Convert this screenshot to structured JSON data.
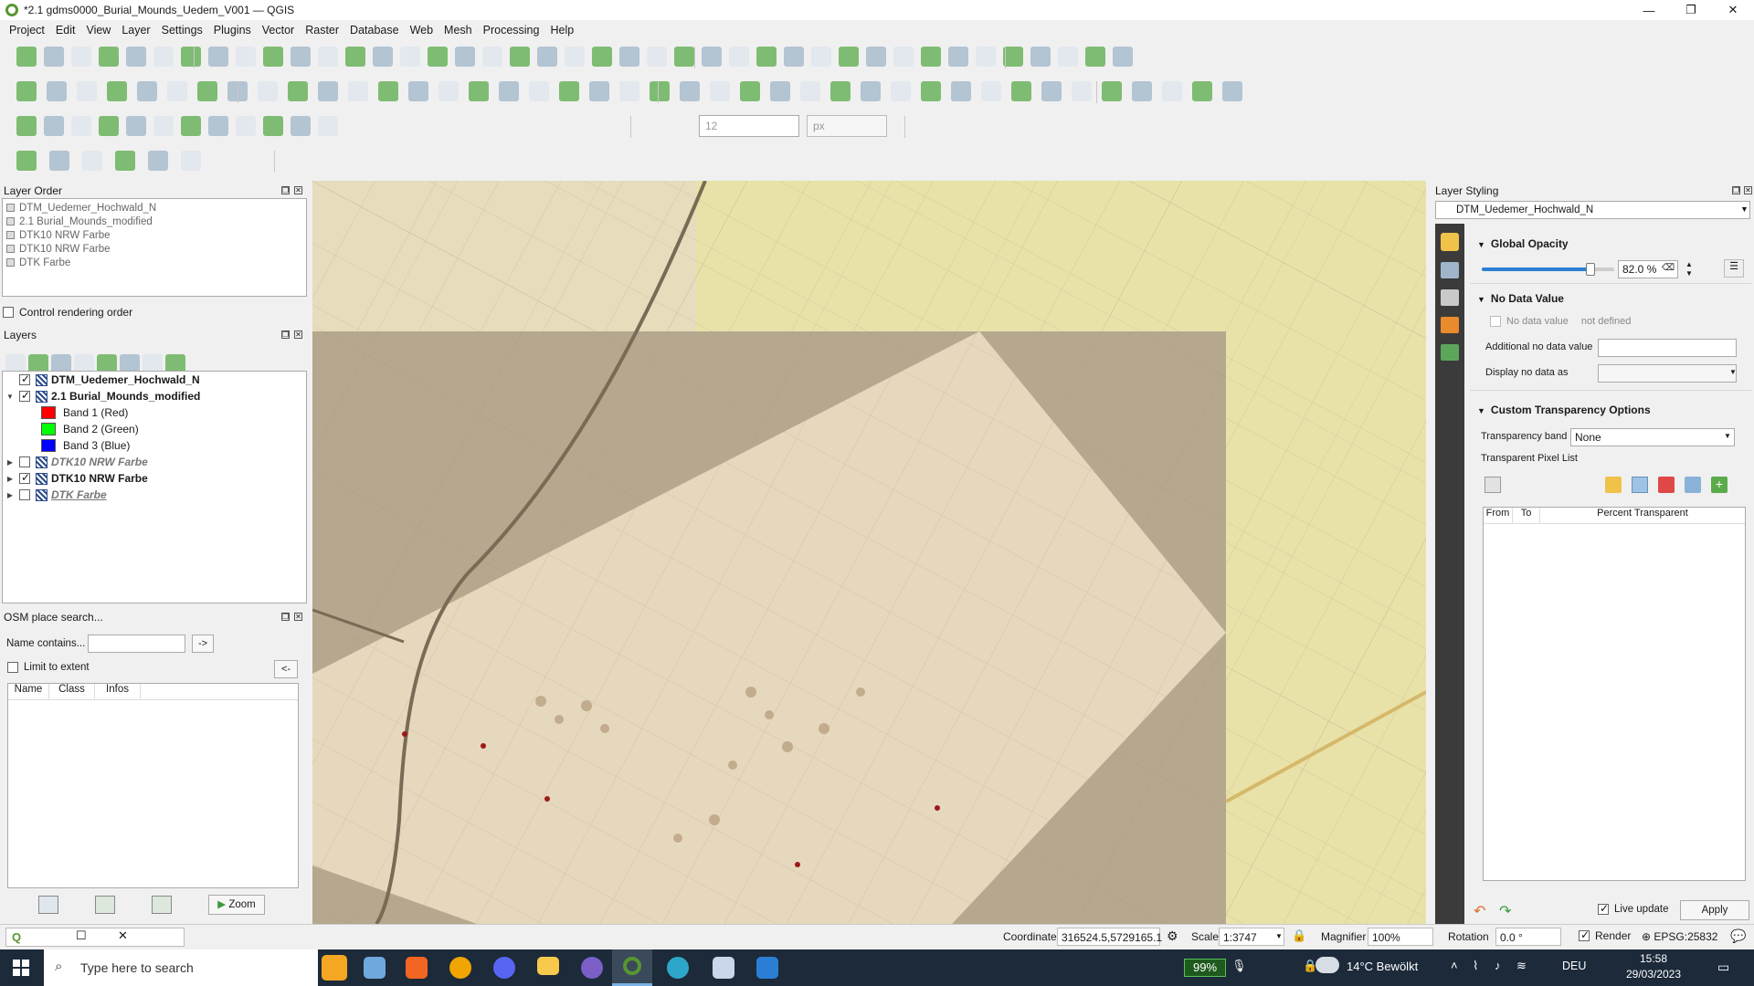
{
  "window": {
    "title": "*2.1 gdms0000_Burial_Mounds_Uedem_V001 — QGIS"
  },
  "menu": [
    "Project",
    "Edit",
    "View",
    "Layer",
    "Settings",
    "Plugins",
    "Vector",
    "Raster",
    "Database",
    "Web",
    "Mesh",
    "Processing",
    "Help"
  ],
  "digitize": {
    "size_value": "12",
    "unit": "px"
  },
  "layer_order": {
    "title": "Layer Order",
    "items": [
      "DTM_Uedemer_Hochwald_N",
      "2.1 Burial_Mounds_modified",
      "DTK10 NRW Farbe",
      "DTK10 NRW Farbe",
      "DTK Farbe"
    ],
    "control_label": "Control rendering order"
  },
  "layers": {
    "title": "Layers",
    "rows": [
      {
        "name": "DTM_Uedemer_Hochwald_N",
        "checked": true
      },
      {
        "name": "2.1 Burial_Mounds_modified",
        "checked": true
      },
      {
        "name": "DTK10 NRW Farbe",
        "checked": false
      },
      {
        "name": "DTK10 NRW Farbe",
        "checked": true
      },
      {
        "name": "DTK Farbe",
        "checked": false
      }
    ],
    "bands": [
      {
        "label": "Band 1 (Red)",
        "color": "#ff0000"
      },
      {
        "label": "Band 2 (Green)",
        "color": "#00ff00"
      },
      {
        "label": "Band 3 (Blue)",
        "color": "#0000ff"
      }
    ]
  },
  "osm": {
    "title": "OSM place search...",
    "name_label": "Name contains...",
    "go_btn": "->",
    "limit_label": "Limit to extent",
    "back_btn": "<-",
    "columns": [
      "Name",
      "Class",
      "Infos"
    ],
    "zoom_btn": "Zoom"
  },
  "styling": {
    "title": "Layer Styling",
    "layer_select": "DTM_Uedemer_Hochwald_N",
    "global_opacity": {
      "title": "Global Opacity",
      "value": "82.0 %",
      "level": 0.82
    },
    "no_data": {
      "title": "No Data Value",
      "checkbox_label": "No data value",
      "not_defined": "not defined",
      "additional_label": "Additional no data value",
      "display_label": "Display no data as"
    },
    "transparency": {
      "title": "Custom Transparency Options",
      "band_label": "Transparency band",
      "band_value": "None",
      "pixel_list_label": "Transparent Pixel List",
      "columns": [
        "From",
        "To",
        "Percent Transparent"
      ]
    },
    "live_update": "Live update",
    "apply": "Apply"
  },
  "status": {
    "coordinate_label": "Coordinate",
    "coordinate_value": "316524.5,5729165.1",
    "scale_label": "Scale",
    "scale_value": "1:3747",
    "magnifier_label": "Magnifier",
    "magnifier_value": "100%",
    "rotation_label": "Rotation",
    "rotation_value": "0.0 °",
    "render_label": "Render",
    "crs": "EPSG:25832"
  },
  "taskbar": {
    "search_placeholder": "Type here to search",
    "battery": "99%",
    "weather": "14°C  Bewölkt",
    "lang": "DEU",
    "time": "15:58",
    "date": "29/03/2023"
  },
  "colors": {
    "accent": "#2a7fd4",
    "qgis_green": "#589632"
  }
}
